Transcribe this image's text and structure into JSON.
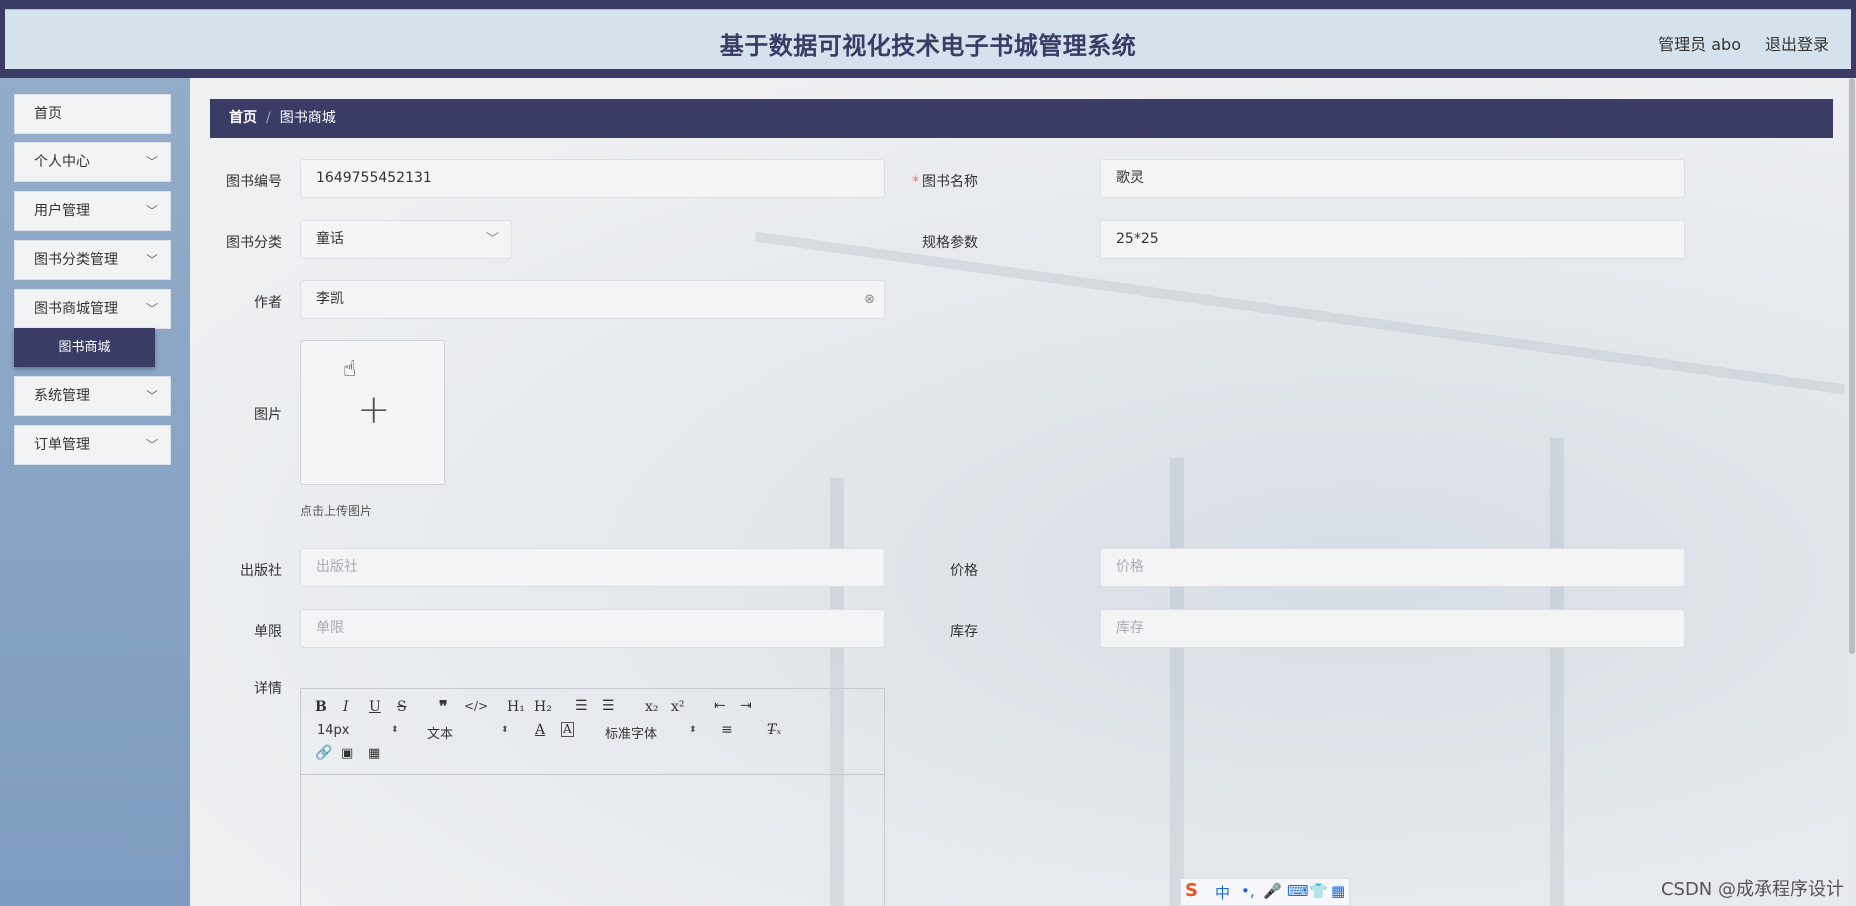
{
  "header": {
    "title": "基于数据可视化技术电子书城管理系统",
    "admin": "管理员 abo",
    "logout": "退出登录"
  },
  "sidebar": {
    "items": [
      {
        "label": "首页",
        "has_chevron": false
      },
      {
        "label": "个人中心",
        "has_chevron": true
      },
      {
        "label": "用户管理",
        "has_chevron": true
      },
      {
        "label": "图书分类管理",
        "has_chevron": true
      },
      {
        "label": "图书商城管理",
        "has_chevron": true
      },
      {
        "label": "系统管理",
        "has_chevron": true
      },
      {
        "label": "订单管理",
        "has_chevron": true
      }
    ],
    "sub_item": "图书商城"
  },
  "breadcrumb": {
    "home": "首页",
    "separator": "/",
    "current": "图书商城"
  },
  "form": {
    "book_no_label": "图书编号",
    "book_no_value": "1649755452131",
    "book_name_label": "图书名称",
    "book_name_required": "*",
    "book_name_value": "歌灵",
    "category_label": "图书分类",
    "category_value": "童话",
    "spec_label": "规格参数",
    "spec_value": "25*25",
    "author_label": "作者",
    "author_value": "李凯",
    "image_label": "图片",
    "upload_tip": "点击上传图片",
    "publisher_label": "出版社",
    "publisher_placeholder": "出版社",
    "price_label": "价格",
    "price_placeholder": "价格",
    "limit_label": "单限",
    "limit_placeholder": "单限",
    "stock_label": "库存",
    "stock_placeholder": "库存",
    "detail_label": "详情"
  },
  "editor": {
    "font_size": "14px",
    "text_style": "文本",
    "font_family": "标准字体"
  },
  "ime": {
    "mode": "中"
  },
  "watermark": "CSDN @成承程序设计",
  "colors": {
    "primary": "#3a3c66",
    "header_bg": "#d3e2ec",
    "required": "#f56c6c"
  }
}
